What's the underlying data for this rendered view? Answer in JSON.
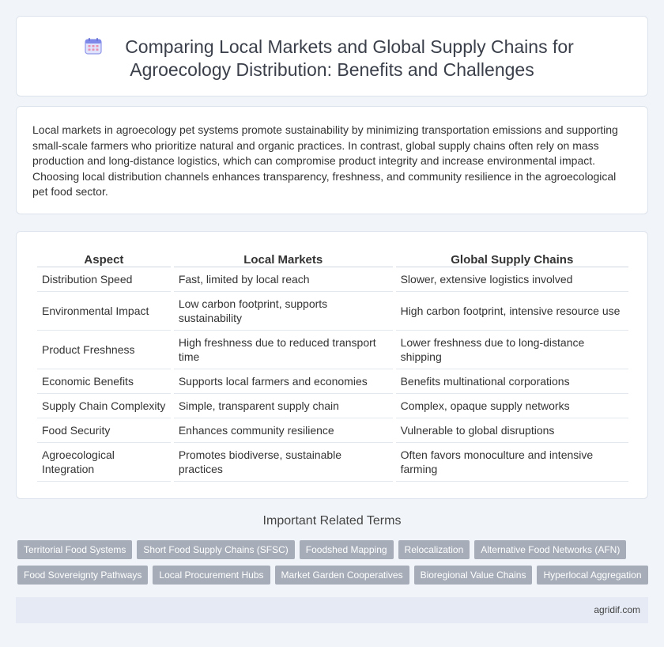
{
  "header": {
    "title_line1": "Comparing Local Markets and Global Supply Chains for",
    "title_line2": "Agroecology Distribution: Benefits and Challenges",
    "icon": "calendar-icon"
  },
  "intro": "Local markets in agroecology pet systems promote sustainability by minimizing transportation emissions and supporting small-scale farmers who prioritize natural and organic practices. In contrast, global supply chains often rely on mass production and long-distance logistics, which can compromise product integrity and increase environmental impact. Choosing local distribution channels enhances transparency, freshness, and community resilience in the agroecological pet food sector.",
  "table": {
    "headers": [
      "Aspect",
      "Local Markets",
      "Global Supply Chains"
    ],
    "rows": [
      [
        "Distribution Speed",
        "Fast, limited by local reach",
        "Slower, extensive logistics involved"
      ],
      [
        "Environmental Impact",
        "Low carbon footprint, supports sustainability",
        "High carbon footprint, intensive resource use"
      ],
      [
        "Product Freshness",
        "High freshness due to reduced transport time",
        "Lower freshness due to long-distance shipping"
      ],
      [
        "Economic Benefits",
        "Supports local farmers and economies",
        "Benefits multinational corporations"
      ],
      [
        "Supply Chain Complexity",
        "Simple, transparent supply chain",
        "Complex, opaque supply networks"
      ],
      [
        "Food Security",
        "Enhances community resilience",
        "Vulnerable to global disruptions"
      ],
      [
        "Agroecological Integration",
        "Promotes biodiverse, sustainable practices",
        "Often favors monoculture and intensive farming"
      ]
    ]
  },
  "related": {
    "title": "Important Related Terms",
    "row1": [
      "Territorial Food Systems",
      "Short Food Supply Chains (SFSC)",
      "Foodshed Mapping",
      "Relocalization",
      "Alternative Food Networks (AFN)"
    ],
    "row2": [
      "Food Sovereignty Pathways",
      "Local Procurement Hubs",
      "Market Garden Cooperatives",
      "Bioregional Value Chains",
      "Hyperlocal Aggregation"
    ]
  },
  "footer": "agridif.com"
}
